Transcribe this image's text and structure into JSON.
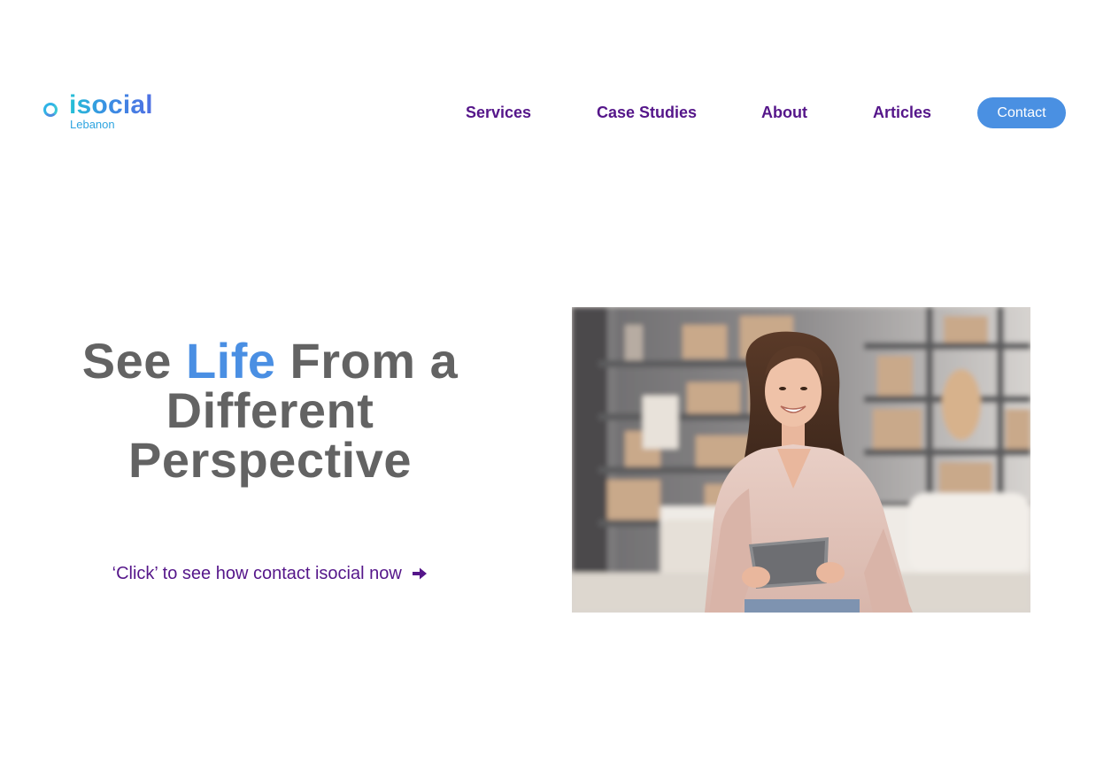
{
  "brand": {
    "name": "isocial",
    "tagline": "Lebanon"
  },
  "nav": {
    "items": [
      {
        "label": "Services"
      },
      {
        "label": "Case Studies"
      },
      {
        "label": "About"
      },
      {
        "label": "Articles"
      }
    ],
    "contact_label": "Contact"
  },
  "hero": {
    "headline_part1": "See ",
    "headline_accent": "Life",
    "headline_part2": " From a",
    "headline_line2": "Different",
    "headline_line3": "Perspective",
    "cta_text": "‘Click’ to see how contact isocial now",
    "cta_icon": "arrow-right-icon",
    "image_name": "woman-holding-tablet-photo"
  },
  "colors": {
    "nav_text": "#55168a",
    "accent": "#4a8fe3",
    "headline_gray": "#636363",
    "button_bg": "#4a90e2",
    "logo_gradient_start": "#25c1d6",
    "logo_gradient_end": "#4f6fe3"
  }
}
